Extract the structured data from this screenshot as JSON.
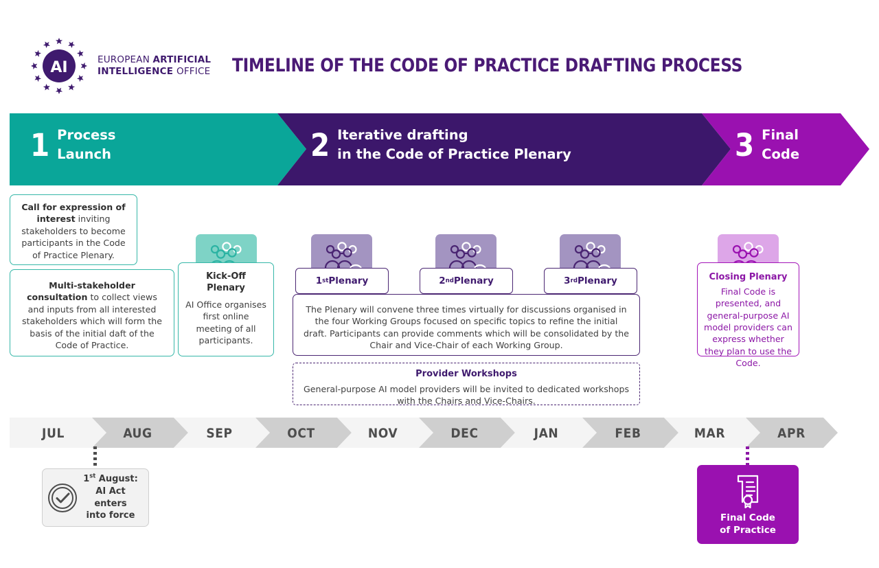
{
  "header": {
    "logo_icon": "eu-ai-office-stars-logo",
    "logo_line1_a": "EUROPEAN ",
    "logo_line1_b": "ARTIFICIAL",
    "logo_line2_a": "INTELLIGENCE ",
    "logo_line2_b": "OFFICE",
    "title": "TIMELINE OF THE CODE OF PRACTICE DRAFTING PROCESS"
  },
  "colors": {
    "teal": "#0aa699",
    "dark_purple": "#3c176b",
    "magenta": "#9a11b0",
    "title_purple": "#4a1a75",
    "month_light": "#f4f4f4",
    "month_dark": "#cfcfcf"
  },
  "phases": [
    {
      "number": "1",
      "line1": "Process",
      "line2": "Launch",
      "color": "#0aa699"
    },
    {
      "number": "2",
      "line1": "Iterative drafting",
      "line2": "in the Code of Practice Plenary",
      "color": "#3c176b"
    },
    {
      "number": "3",
      "line1": "Final",
      "line2": "Code",
      "color": "#9a11b0"
    }
  ],
  "phase1": {
    "call_card": {
      "bold": "Call for expression of interest",
      "rest": " inviting stakeholders to become participants in the Code of Practice Plenary."
    },
    "consultation_card": {
      "bold": "Multi-stakeholder consultation",
      "rest": " to collect views and inputs from all interested stakeholders which will form the basis of the initial daft of the Code of Practice."
    },
    "kickoff_card": {
      "icon": "group-of-people-icon",
      "title_line1": "Kick-Off",
      "title_line2": "Plenary",
      "body": "AI Office organises first online meeting of all participants."
    }
  },
  "phase2": {
    "plenaries": [
      {
        "ordinal": "1",
        "suffix": "st",
        "label": " Plenary",
        "icon": "group-of-people-icon"
      },
      {
        "ordinal": "2",
        "suffix": "nd",
        "label": " Plenary",
        "icon": "group-of-people-icon"
      },
      {
        "ordinal": "3",
        "suffix": "rd",
        "label": " Plenary",
        "icon": "group-of-people-icon"
      }
    ],
    "plenary_description": "The Plenary will convene three times virtually for discussions organised in the four Working Groups focused on specific topics to refine the initial draft. Participants can provide comments which will be consolidated by the Chair and Vice-Chair of each Working Group.",
    "workshops": {
      "title": "Provider Workshops",
      "body": "General-purpose AI model providers will be invited to dedicated workshops with the Chairs and Vice-Chairs."
    }
  },
  "phase3": {
    "closing_card": {
      "icon": "group-of-people-icon",
      "title": "Closing Plenary",
      "body": "Final Code is presented, and general-purpose AI model providers can express whether they plan to use the Code."
    }
  },
  "timeline": {
    "months": [
      "JUL",
      "AUG",
      "SEP",
      "OCT",
      "NOV",
      "DEC",
      "JAN",
      "FEB",
      "MAR",
      "APR"
    ]
  },
  "callouts": {
    "ai_act": {
      "icon": "check-circle-icon",
      "date_num": "1",
      "date_suffix": "st",
      "date_month": " August:",
      "line2": "AI Act enters",
      "line3": "into force",
      "anchor_month": "AUG"
    },
    "final_code": {
      "icon": "certificate-seal-icon",
      "line1": "Final Code",
      "line2": "of Practice",
      "anchor_month": "MAR"
    }
  }
}
